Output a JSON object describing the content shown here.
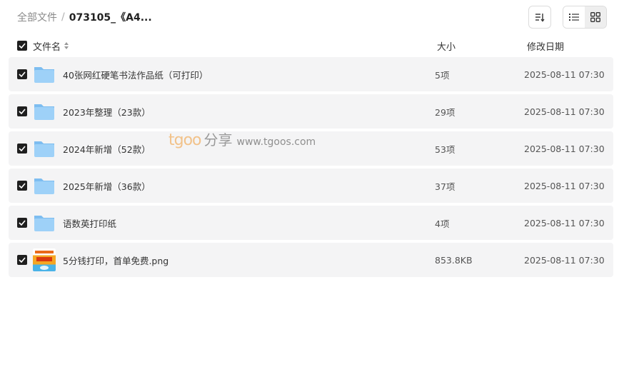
{
  "breadcrumb": {
    "root": "全部文件",
    "separator": "/",
    "current": "073105_《A4..."
  },
  "toolbar": {
    "sort_icon": "sort-icon",
    "list_view_icon": "list-view-icon",
    "grid_view_icon": "grid-view-icon"
  },
  "table": {
    "headers": {
      "name": "文件名",
      "size": "大小",
      "modified": "修改日期"
    },
    "rows": [
      {
        "type": "folder",
        "name": "40张网红硬笔书法作品纸（可打印）",
        "size": "5项",
        "date": "2025-08-11 07:30",
        "checked": true
      },
      {
        "type": "folder",
        "name": "2023年整理（23款）",
        "size": "29项",
        "date": "2025-08-11 07:30",
        "checked": true
      },
      {
        "type": "folder",
        "name": "2024年新增（52款）",
        "size": "53项",
        "date": "2025-08-11 07:30",
        "checked": true
      },
      {
        "type": "folder",
        "name": "2025年新增（36款）",
        "size": "37项",
        "date": "2025-08-11 07:30",
        "checked": true
      },
      {
        "type": "folder",
        "name": "语数英打印纸",
        "size": "4项",
        "date": "2025-08-11 07:30",
        "checked": true
      },
      {
        "type": "image",
        "name": "5分钱打印，首单免费.png",
        "size": "853.8KB",
        "date": "2025-08-11 07:30",
        "checked": true
      }
    ]
  },
  "watermark": {
    "brand": "tgoo",
    "cn": "分享",
    "url": "www.tgoos.com"
  },
  "colors": {
    "row_bg": "#f4f4f5",
    "folder_blue": "#8cc8f5",
    "checkbox": "#1f1f1f"
  }
}
